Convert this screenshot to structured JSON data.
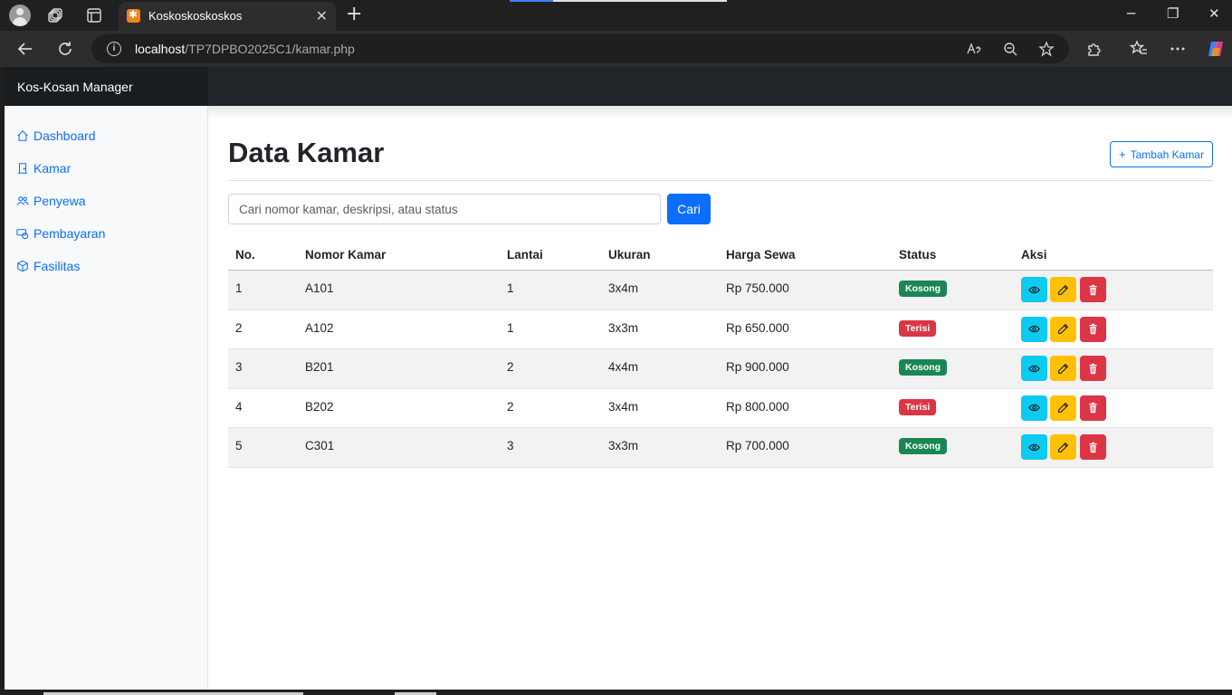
{
  "browser": {
    "tab_title": "Koskoskoskoskos",
    "url_host": "localhost",
    "url_path": "/TP7DPBO2025C1/kamar.php"
  },
  "navbar": {
    "brand": "Kos-Kosan Manager"
  },
  "sidebar": {
    "items": [
      {
        "label": "Dashboard",
        "icon": "house-icon"
      },
      {
        "label": "Kamar",
        "icon": "door-icon"
      },
      {
        "label": "Penyewa",
        "icon": "people-icon"
      },
      {
        "label": "Pembayaran",
        "icon": "cash-coin-icon"
      },
      {
        "label": "Fasilitas",
        "icon": "box-icon"
      }
    ]
  },
  "main": {
    "title": "Data Kamar",
    "add_button": "Tambah Kamar",
    "search": {
      "placeholder": "Cari nomor kamar, deskripsi, atau status",
      "value": "",
      "button": "Cari"
    },
    "table": {
      "headers": [
        "No.",
        "Nomor Kamar",
        "Lantai",
        "Ukuran",
        "Harga Sewa",
        "Status",
        "Aksi"
      ],
      "rows": [
        {
          "no": "1",
          "nomor": "A101",
          "lantai": "1",
          "ukuran": "3x4m",
          "harga": "Rp 750.000",
          "status": "Kosong"
        },
        {
          "no": "2",
          "nomor": "A102",
          "lantai": "1",
          "ukuran": "3x3m",
          "harga": "Rp 650.000",
          "status": "Terisi"
        },
        {
          "no": "3",
          "nomor": "B201",
          "lantai": "2",
          "ukuran": "4x4m",
          "harga": "Rp 900.000",
          "status": "Kosong"
        },
        {
          "no": "4",
          "nomor": "B202",
          "lantai": "2",
          "ukuran": "3x4m",
          "harga": "Rp 800.000",
          "status": "Terisi"
        },
        {
          "no": "5",
          "nomor": "C301",
          "lantai": "3",
          "ukuran": "3x3m",
          "harga": "Rp 700.000",
          "status": "Kosong"
        }
      ]
    }
  },
  "colors": {
    "primary": "#0d6efd",
    "success": "#198754",
    "danger": "#dc3545",
    "info": "#0dcaf0",
    "warning": "#ffc107",
    "navbar": "#212529"
  }
}
